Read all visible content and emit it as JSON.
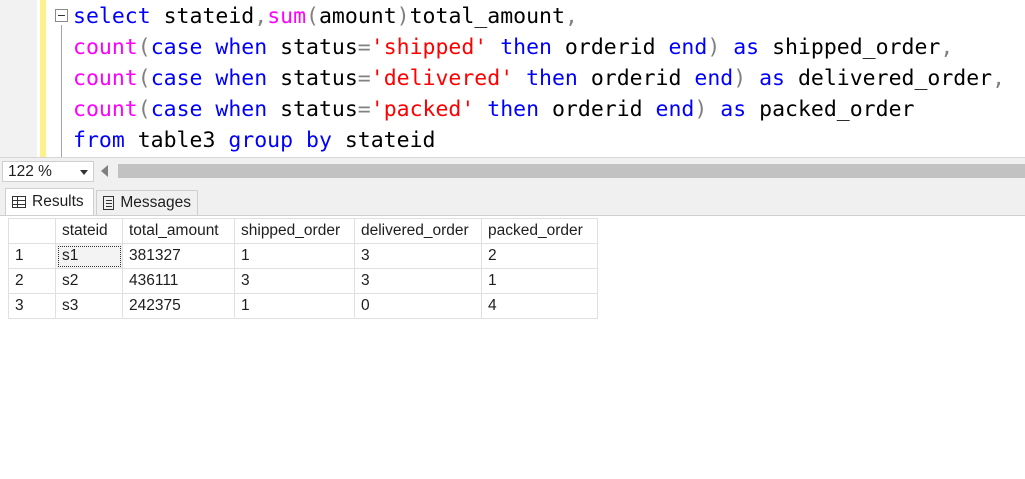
{
  "editor": {
    "lines": [
      [
        {
          "t": "select",
          "c": "kw"
        },
        {
          "t": " stateid",
          "c": ""
        },
        {
          "t": ",",
          "c": "gr"
        },
        {
          "t": "sum",
          "c": "fn"
        },
        {
          "t": "(",
          "c": "gr"
        },
        {
          "t": "amount",
          "c": ""
        },
        {
          "t": ")",
          "c": "gr"
        },
        {
          "t": "total_amount",
          "c": ""
        },
        {
          "t": ",",
          "c": "gr"
        }
      ],
      [
        {
          "t": "count",
          "c": "fn"
        },
        {
          "t": "(",
          "c": "gr"
        },
        {
          "t": "case when",
          "c": "kw"
        },
        {
          "t": " status",
          "c": ""
        },
        {
          "t": "=",
          "c": "gr"
        },
        {
          "t": "'shipped'",
          "c": "str"
        },
        {
          "t": " then",
          "c": "kw"
        },
        {
          "t": " orderid ",
          "c": ""
        },
        {
          "t": "end",
          "c": "kw"
        },
        {
          "t": ")",
          "c": "gr"
        },
        {
          "t": " as",
          "c": "kw"
        },
        {
          "t": " shipped_order",
          "c": ""
        },
        {
          "t": ",",
          "c": "gr"
        }
      ],
      [
        {
          "t": "count",
          "c": "fn"
        },
        {
          "t": "(",
          "c": "gr"
        },
        {
          "t": "case when",
          "c": "kw"
        },
        {
          "t": " status",
          "c": ""
        },
        {
          "t": "=",
          "c": "gr"
        },
        {
          "t": "'delivered'",
          "c": "str"
        },
        {
          "t": " then",
          "c": "kw"
        },
        {
          "t": " orderid ",
          "c": ""
        },
        {
          "t": "end",
          "c": "kw"
        },
        {
          "t": ")",
          "c": "gr"
        },
        {
          "t": " as",
          "c": "kw"
        },
        {
          "t": " delivered_order",
          "c": ""
        },
        {
          "t": ",",
          "c": "gr"
        }
      ],
      [
        {
          "t": "count",
          "c": "fn"
        },
        {
          "t": "(",
          "c": "gr"
        },
        {
          "t": "case when",
          "c": "kw"
        },
        {
          "t": " status",
          "c": ""
        },
        {
          "t": "=",
          "c": "gr"
        },
        {
          "t": "'packed'",
          "c": "str"
        },
        {
          "t": " then",
          "c": "kw"
        },
        {
          "t": " orderid ",
          "c": ""
        },
        {
          "t": "end",
          "c": "kw"
        },
        {
          "t": ")",
          "c": "gr"
        },
        {
          "t": " as",
          "c": "kw"
        },
        {
          "t": " packed_order",
          "c": ""
        }
      ],
      [
        {
          "t": "from",
          "c": "kw"
        },
        {
          "t": " table3 ",
          "c": ""
        },
        {
          "t": "group by",
          "c": "kw"
        },
        {
          "t": " stateid",
          "c": ""
        }
      ]
    ]
  },
  "zoom": {
    "value": "122 %"
  },
  "tabs": {
    "results": "Results",
    "messages": "Messages"
  },
  "grid": {
    "columns": [
      "stateid",
      "total_amount",
      "shipped_order",
      "delivered_order",
      "packed_order"
    ],
    "rows": [
      {
        "num": "1",
        "cells": [
          "s1",
          "381327",
          "1",
          "3",
          "2"
        ]
      },
      {
        "num": "2",
        "cells": [
          "s2",
          "436111",
          "3",
          "3",
          "1"
        ]
      },
      {
        "num": "3",
        "cells": [
          "s3",
          "242375",
          "1",
          "0",
          "4"
        ]
      }
    ]
  },
  "colors": {
    "keyword": "#0000ff",
    "function": "#ff00ff",
    "string": "#ff0000",
    "operator": "#808080"
  }
}
